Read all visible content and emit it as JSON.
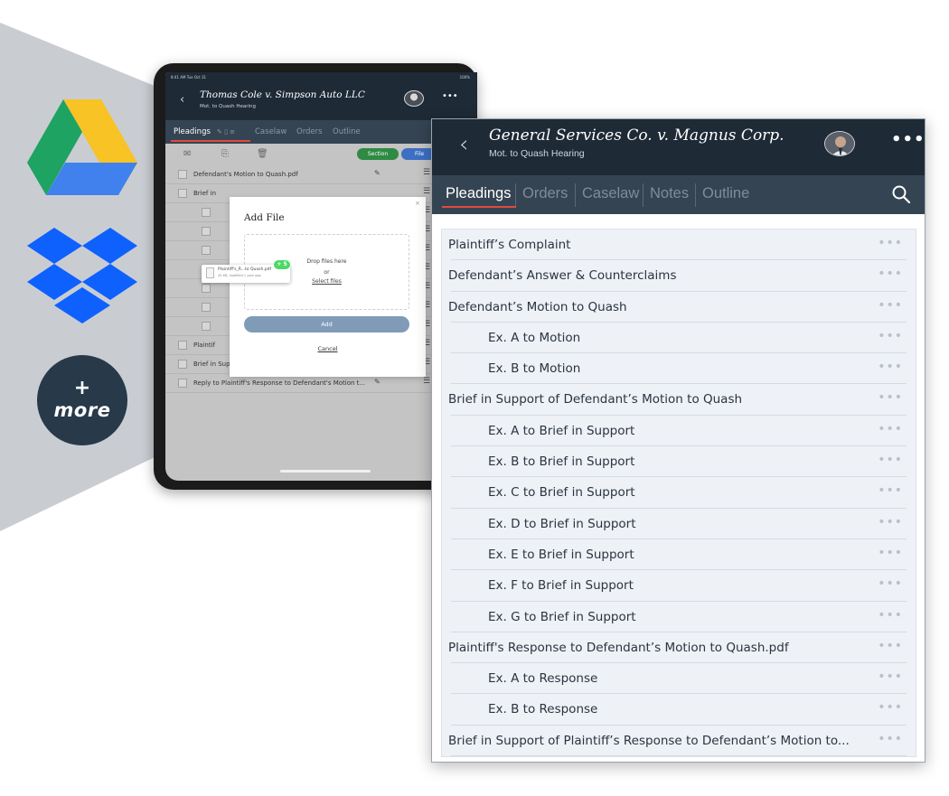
{
  "ipad": {
    "status_time": "8:41 AM  Tue Oct 31",
    "status_right": "100%",
    "title": "Thomas Cole v. Simpson Auto LLC",
    "subtitle": "Mot. to Quash Hearing",
    "tabs": [
      "Pleadings",
      "Caselaw",
      "Orders",
      "Outline"
    ],
    "section_button": "Section",
    "file_button": "File",
    "rows": [
      {
        "label": "Defendant's Motion to Quash.pdf",
        "sub": false
      },
      {
        "label": "Brief in",
        "sub": false
      },
      {
        "label": "",
        "sub": true
      },
      {
        "label": "",
        "sub": true
      },
      {
        "label": "",
        "sub": true
      },
      {
        "label": "",
        "sub": true
      },
      {
        "label": "",
        "sub": true
      },
      {
        "label": "",
        "sub": true
      },
      {
        "label": "",
        "sub": true
      },
      {
        "label": "Plaintif",
        "sub": false
      },
      {
        "label": "Brief in Support of Plaintiff's Response to Defendant...",
        "sub": false
      },
      {
        "label": "Reply to Plaintiff's Response to Defendant's Motion t...",
        "sub": false
      }
    ],
    "modal": {
      "title": "Add File",
      "drop_text": "Drop files here",
      "or_text": "or",
      "select_text": "Select files",
      "add_label": "Add",
      "cancel_label": "Cancel",
      "close": "×"
    },
    "drag_chip": {
      "name": "Plaintiff's_R...to Quash.pdf",
      "meta": "45 KB, modified 1 year ago",
      "badge": "+ 5"
    }
  },
  "panel": {
    "title": "General Services Co. v. Magnus Corp.",
    "subtitle": "Mot. to Quash Hearing",
    "tabs": [
      "Pleadings",
      "Orders",
      "Caselaw",
      "Notes",
      "Outline"
    ],
    "active_tab": "Pleadings",
    "more_glyph": "•••",
    "row_more_glyph": "•••",
    "rows": [
      {
        "label": "Plaintiff’s Complaint",
        "sub": false
      },
      {
        "label": "Defendant’s Answer & Counterclaims",
        "sub": false
      },
      {
        "label": "Defendant’s Motion to Quash",
        "sub": false
      },
      {
        "label": "Ex. A to Motion",
        "sub": true
      },
      {
        "label": "Ex. B to Motion",
        "sub": true
      },
      {
        "label": "Brief in Support of Defendant’s Motion to Quash",
        "sub": false
      },
      {
        "label": "Ex. A to Brief in Support",
        "sub": true
      },
      {
        "label": "Ex. B to Brief in Support",
        "sub": true
      },
      {
        "label": "Ex. C to Brief in Support",
        "sub": true
      },
      {
        "label": "Ex. D to Brief in Support",
        "sub": true
      },
      {
        "label": "Ex. E to Brief in Support",
        "sub": true
      },
      {
        "label": "Ex. F to Brief in Support",
        "sub": true
      },
      {
        "label": "Ex. G to Brief in Support",
        "sub": true
      },
      {
        "label": "Plaintiff's Response to Defendant’s Motion to Quash.pdf",
        "sub": false
      },
      {
        "label": "Ex. A to Response",
        "sub": true
      },
      {
        "label": "Ex. B to Response",
        "sub": true
      },
      {
        "label": "Brief in Support of Plaintiff’s Response to Defendant’s Motion to...",
        "sub": false
      }
    ]
  },
  "integrations": {
    "more_plus": "+",
    "more_label": "more",
    "items": [
      "google-drive",
      "dropbox",
      "more"
    ]
  },
  "colors": {
    "header": "#1e2a36",
    "tabbar": "#354453",
    "accent_red": "#e04a3b",
    "list_bg": "#eef1f6",
    "backdrop_gray": "#c9cdd2"
  }
}
